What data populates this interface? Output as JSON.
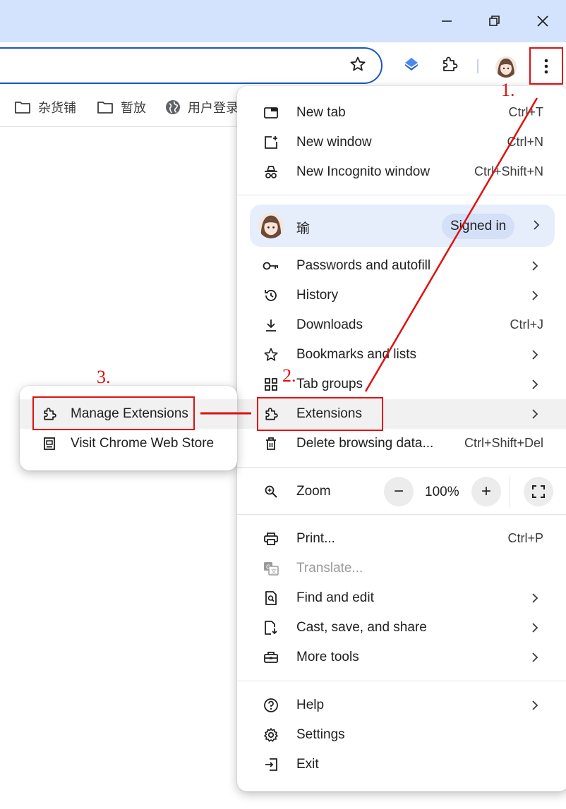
{
  "window_controls": {
    "minimize_icon": "minimize-icon",
    "restore_icon": "restore-icon",
    "close_icon": "close-icon"
  },
  "toolbar": {
    "bookmark_star_icon": "star-icon",
    "extensions_icon": "puzzle-icon",
    "menu_icon": "three-dots-icon"
  },
  "bookmarks_bar": {
    "items": [
      {
        "label": "杂货铺",
        "icon": "folder-icon"
      },
      {
        "label": "暂放",
        "icon": "folder-icon"
      },
      {
        "label": "用户登录",
        "icon": "globe-icon"
      }
    ]
  },
  "menu": {
    "new_tab": {
      "label": "New tab",
      "shortcut": "Ctrl+T"
    },
    "new_window": {
      "label": "New window",
      "shortcut": "Ctrl+N"
    },
    "new_incognito": {
      "label": "New Incognito window",
      "shortcut": "Ctrl+Shift+N"
    },
    "profile": {
      "name": "瑜",
      "status": "Signed in"
    },
    "passwords": {
      "label": "Passwords and autofill"
    },
    "history": {
      "label": "History"
    },
    "downloads": {
      "label": "Downloads",
      "shortcut": "Ctrl+J"
    },
    "bookmarks": {
      "label": "Bookmarks and lists"
    },
    "tab_groups": {
      "label": "Tab groups"
    },
    "extensions": {
      "label": "Extensions"
    },
    "delete_data": {
      "label": "Delete browsing data...",
      "shortcut": "Ctrl+Shift+Del"
    },
    "zoom": {
      "label": "Zoom",
      "value": "100%",
      "minus": "−",
      "plus": "+"
    },
    "print": {
      "label": "Print...",
      "shortcut": "Ctrl+P"
    },
    "translate": {
      "label": "Translate..."
    },
    "find_edit": {
      "label": "Find and edit"
    },
    "cast_save": {
      "label": "Cast, save, and share"
    },
    "more_tools": {
      "label": "More tools"
    },
    "help": {
      "label": "Help"
    },
    "settings": {
      "label": "Settings"
    },
    "exit": {
      "label": "Exit"
    }
  },
  "submenu": {
    "manage_extensions": {
      "label": "Manage Extensions"
    },
    "visit_store": {
      "label": "Visit Chrome Web Store"
    }
  },
  "annotations": {
    "step1": "1.",
    "step2": "2.",
    "step3": "3.",
    "color": "#e01010"
  },
  "colors": {
    "titlebar": "#d3e3fd",
    "omnibox_border": "#1a56c4",
    "profile_bg": "#e6edfb",
    "hover_bg": "#f1f1f1"
  }
}
